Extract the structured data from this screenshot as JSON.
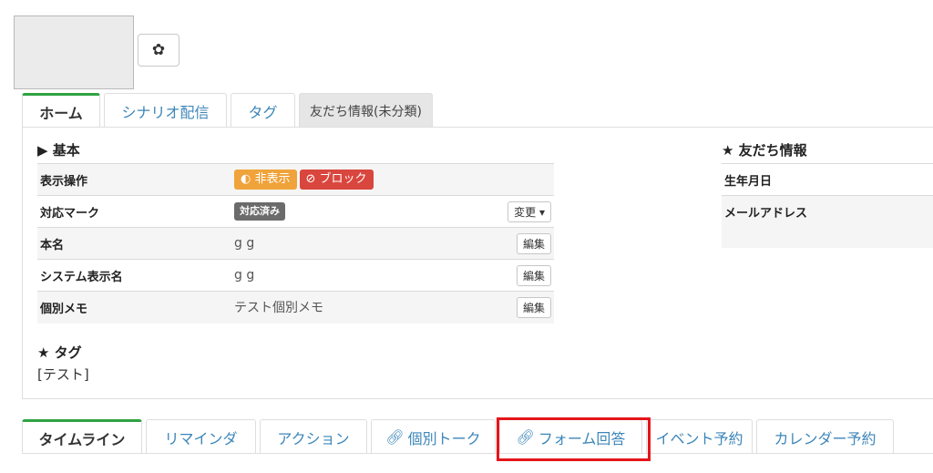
{
  "header": {
    "settings_icon": "gear-icon"
  },
  "top_tabs": [
    {
      "label": "ホーム",
      "active": true
    },
    {
      "label": "シナリオ配信"
    },
    {
      "label": "タグ"
    },
    {
      "label": "友だち情報(未分類)"
    }
  ],
  "basic": {
    "title": "▶ 基本",
    "rows": {
      "display": {
        "label": "表示操作",
        "hide_label": "非表示",
        "block_label": "ブロック",
        "hide_icon": "eye-slash-icon",
        "block_icon": "ban-icon"
      },
      "mark": {
        "label": "対応マーク",
        "value": "対応済み",
        "button": "変更 ▾"
      },
      "real_name": {
        "label": "本名",
        "value": "g g",
        "button": "編集"
      },
      "system_name": {
        "label": "システム表示名",
        "value": "g g",
        "button": "編集"
      },
      "memo": {
        "label": "個別メモ",
        "value": "テスト個別メモ",
        "button": "編集"
      }
    }
  },
  "tags": {
    "title": "★ タグ",
    "value": "[テスト]"
  },
  "friend_info": {
    "title": "★ 友だち情報",
    "birthday_label": "生年月日",
    "email_label": "メールアドレス"
  },
  "bottom_tabs": [
    {
      "label": "タイムライン",
      "active": true
    },
    {
      "label": "リマインダ"
    },
    {
      "label": "アクション"
    },
    {
      "label": "個別トーク",
      "icon": "link-icon"
    },
    {
      "label": "フォーム回答",
      "icon": "link-icon",
      "highlighted": true
    },
    {
      "label": "イベント予約"
    },
    {
      "label": "カレンダー予約"
    }
  ],
  "colors": {
    "active_tab": "#2fa342",
    "link": "#3c86b8",
    "highlight": "#e5141b",
    "hide_badge": "#f0a33a",
    "block_badge": "#d9463e"
  }
}
